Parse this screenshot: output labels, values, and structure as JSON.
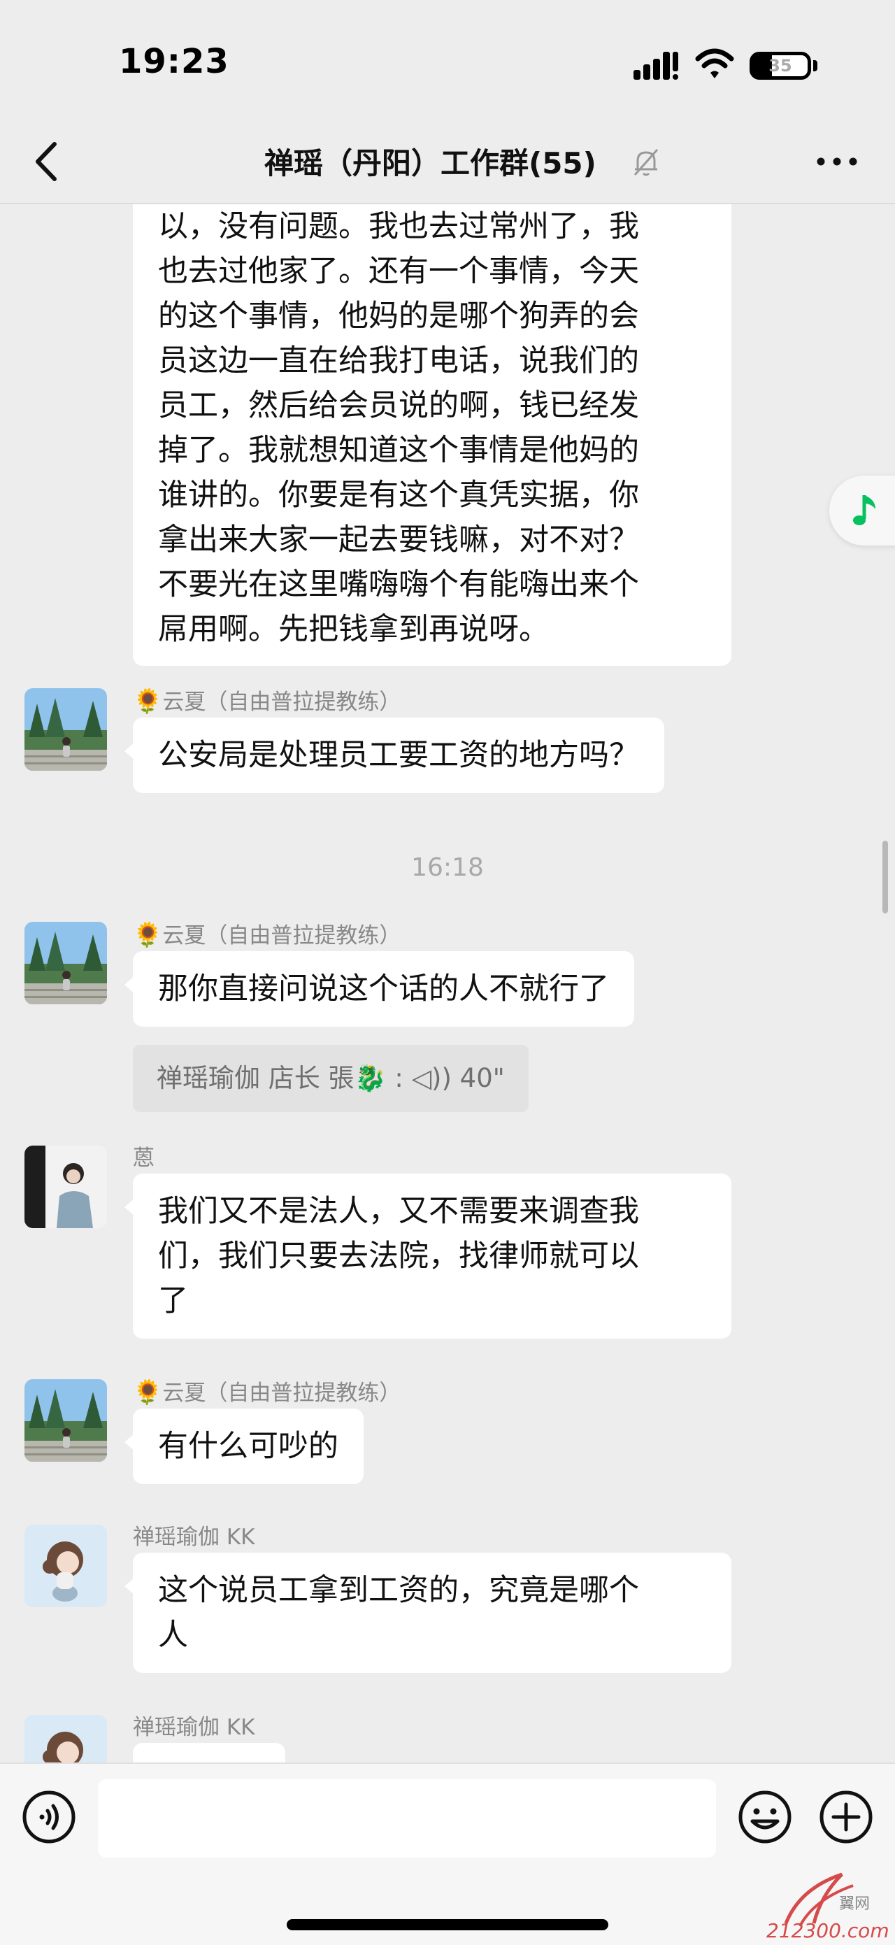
{
  "status_bar": {
    "time": "19:23",
    "battery": "35",
    "battery_fraction": 0.35
  },
  "header": {
    "title": "禅瑶（丹阳）工作群(55)"
  },
  "messages": {
    "m0": {
      "lines": [
        "以，没有问题。我也去过常州了，我",
        "也去过他家了。还有一个事情，今天",
        "的这个事情，他妈的是哪个狗弄的会",
        "员这边一直在给我打电话，说我们的",
        "员工，然后给会员说的啊，钱已经发",
        "掉了。我就想知道这个事情是他妈的",
        "谁讲的。你要是有这个真凭实据，你",
        "拿出来大家一起去要钱嘛，对不对？",
        "不要光在这里嘴嗨嗨个有能嗨出来个",
        "屌用啊。先把钱拿到再说呀。"
      ]
    },
    "m1": {
      "flower": "🌻",
      "sender": "云夏（自由普拉提教练）",
      "text": "公安局是处理员工要工资的地方吗？"
    },
    "time1": "16:18",
    "m2": {
      "flower": "🌻",
      "sender": "云夏（自由普拉提教练）",
      "text": "那你直接问说这个话的人不就行了"
    },
    "quote": {
      "text": "禅瑶瑜伽  店长 張🐉 : ◁)) 40\""
    },
    "m3": {
      "sender": "蒽",
      "lines": [
        "我们又不是法人，又不需要来调查我",
        "们，我们只要去法院，找律师就可以",
        "了"
      ]
    },
    "m4": {
      "flower": "🌻",
      "sender": "云夏（自由普拉提教练）",
      "text": "有什么可吵的"
    },
    "m5": {
      "sender": "禅瑶瑜伽 KK",
      "lines": [
        "这个说员工拿到工资的，究竟是哪个",
        "人"
      ]
    },
    "m6": {
      "sender": "禅瑶瑜伽 KK"
    }
  },
  "watermark": {
    "cn": "翼网",
    "url": "212300.com"
  },
  "colors": {
    "background": "#ededed",
    "bubble": "#ffffff",
    "accent_green": "#07c160",
    "watermark_red": "#d64a4a"
  }
}
